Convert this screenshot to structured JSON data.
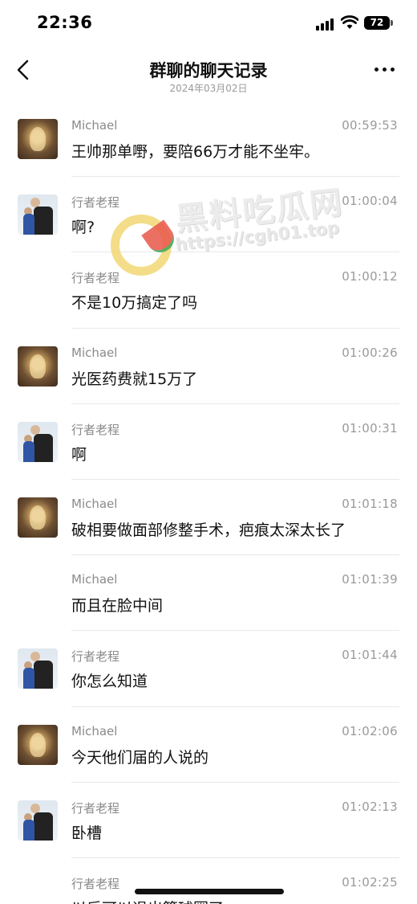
{
  "status_bar": {
    "time": "22:36",
    "battery": "72"
  },
  "nav": {
    "title": "群聊的聊天记录",
    "subtitle": "2024年03月02日"
  },
  "watermark": {
    "title": "黑料吃瓜网",
    "url": "https://cgh01.top"
  },
  "messages": [
    {
      "sender": "Michael",
      "time": "00:59:53",
      "text": "王帅那单嘢，要陪66万才能不坐牢。",
      "avatar": "buddha",
      "show_avatar": true
    },
    {
      "sender": "行者老程",
      "time": "01:00:04",
      "text": "啊?",
      "avatar": "person",
      "show_avatar": true
    },
    {
      "sender": "行者老程",
      "time": "01:00:12",
      "text": "不是10万搞定了吗",
      "avatar": "person",
      "show_avatar": false
    },
    {
      "sender": "Michael",
      "time": "01:00:26",
      "text": "光医药费就15万了",
      "avatar": "buddha",
      "show_avatar": true
    },
    {
      "sender": "行者老程",
      "time": "01:00:31",
      "text": "啊",
      "avatar": "person",
      "show_avatar": true
    },
    {
      "sender": "Michael",
      "time": "01:01:18",
      "text": "破相要做面部修整手术，疤痕太深太长了",
      "avatar": "buddha",
      "show_avatar": true
    },
    {
      "sender": "Michael",
      "time": "01:01:39",
      "text": "而且在脸中间",
      "avatar": "buddha",
      "show_avatar": false
    },
    {
      "sender": "行者老程",
      "time": "01:01:44",
      "text": "你怎么知道",
      "avatar": "person",
      "show_avatar": true
    },
    {
      "sender": "Michael",
      "time": "01:02:06",
      "text": "今天他们届的人说的",
      "avatar": "buddha",
      "show_avatar": true
    },
    {
      "sender": "行者老程",
      "time": "01:02:13",
      "text": "卧槽",
      "avatar": "person",
      "show_avatar": true
    },
    {
      "sender": "行者老程",
      "time": "01:02:25",
      "text": "以后可以退出篮球圈了",
      "avatar": "person",
      "show_avatar": false
    }
  ]
}
